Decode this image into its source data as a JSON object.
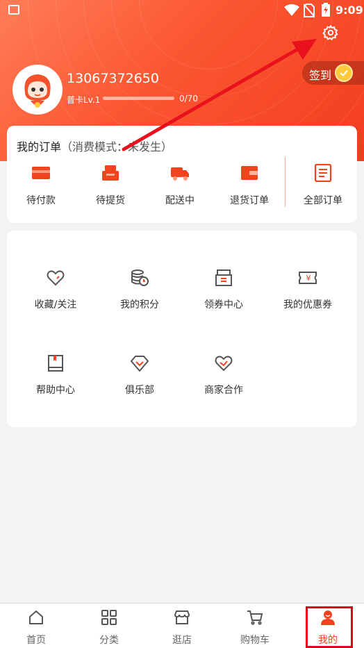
{
  "status_bar": {
    "time": "9:09"
  },
  "header": {
    "phone": "13067372650",
    "level": "普卡Lv.1",
    "points": "0/70",
    "points_fraction": 0.0,
    "checkin_label": "签到"
  },
  "orders": {
    "title": "我的订单",
    "subtitle": "（消费模式：未发生）",
    "items": [
      {
        "label": "待付款",
        "icon": "wallet-card-icon"
      },
      {
        "label": "待提货",
        "icon": "package-box-icon"
      },
      {
        "label": "配送中",
        "icon": "delivery-truck-icon"
      },
      {
        "label": "退货订单",
        "icon": "return-wallet-icon"
      },
      {
        "label": "全部订单",
        "icon": "order-list-icon"
      }
    ]
  },
  "services": [
    {
      "label": "收藏/关注",
      "icon": "heart-icon"
    },
    {
      "label": "我的积分",
      "icon": "coins-icon"
    },
    {
      "label": "领券中心",
      "icon": "coupon-box-icon"
    },
    {
      "label": "我的优惠券",
      "icon": "yen-ticket-icon"
    },
    {
      "label": "帮助中心",
      "icon": "book-icon"
    },
    {
      "label": "俱乐部",
      "icon": "diamond-icon"
    },
    {
      "label": "商家合作",
      "icon": "handshake-heart-icon"
    }
  ],
  "tabbar": [
    {
      "label": "首页",
      "icon": "home-icon"
    },
    {
      "label": "分类",
      "icon": "grid-icon"
    },
    {
      "label": "逛店",
      "icon": "store-icon"
    },
    {
      "label": "购物车",
      "icon": "cart-icon"
    },
    {
      "label": "我的",
      "icon": "profile-icon"
    }
  ],
  "colors": {
    "accent": "#f2431f",
    "highlight_box": "#e0001c",
    "annotation_arrow": "#e8111c"
  }
}
